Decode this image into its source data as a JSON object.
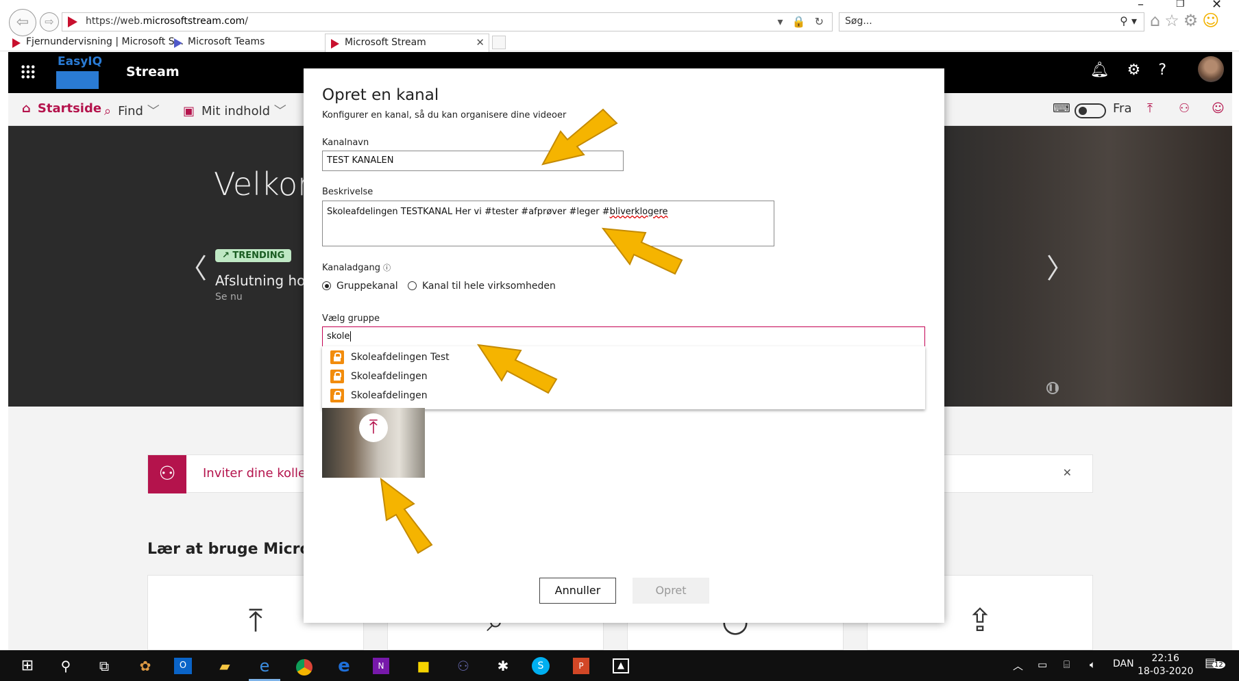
{
  "browser": {
    "url_prefix": "https://web.",
    "url_domain": "microsoftstream.com",
    "url_suffix": "/",
    "search_placeholder": "Søg...",
    "tabs": [
      {
        "label": "Fjernundervisning | Microsoft S..."
      },
      {
        "label": "Microsoft Teams"
      },
      {
        "label": "Microsoft Stream"
      }
    ]
  },
  "app": {
    "logo_text": "EasyIQ",
    "title": "Stream"
  },
  "nav": {
    "home": "Startside",
    "find": "Find",
    "my_content": "Mit indhold",
    "toggle_label": "Fra"
  },
  "hero": {
    "title": "Velkom",
    "badge": "TRENDING",
    "video_title": "Afslutning hold",
    "watch": "Se nu"
  },
  "content": {
    "invite_text": "Inviter dine kollega",
    "learn_title": "Lær at bruge Microsoft"
  },
  "modal": {
    "title": "Opret en kanal",
    "subtitle": "Konfigurer en kanal, så du kan organisere dine videoer",
    "name_label": "Kanalnavn",
    "name_value": "TEST KANALEN",
    "desc_label": "Beskrivelse",
    "desc_value_main": "Skoleafdelingen TESTKANAL Her vi #tester #afprøver #leger #",
    "desc_value_misspelled": "bliverklogere",
    "access_label": "Kanaladgang",
    "access_options": [
      {
        "label": "Gruppekanal",
        "selected": true
      },
      {
        "label": "Kanal til hele virksomheden",
        "selected": false
      }
    ],
    "group_label": "Vælg gruppe",
    "group_value": "skole",
    "group_suggestions": [
      {
        "label": "Skoleafdelingen Test"
      },
      {
        "label": "Skoleafdelingen"
      },
      {
        "label": "Skoleafdelingen"
      }
    ],
    "cancel_label": "Annuller",
    "create_label": "Opret"
  },
  "taskbar": {
    "language": "DAN",
    "time": "22:16",
    "date": "18-03-2020",
    "notification_count": "12"
  },
  "colors": {
    "accent": "#b4134c",
    "arrow_fill": "#f5b400",
    "arrow_edge": "#c48a00",
    "focus_border": "#c30052"
  }
}
